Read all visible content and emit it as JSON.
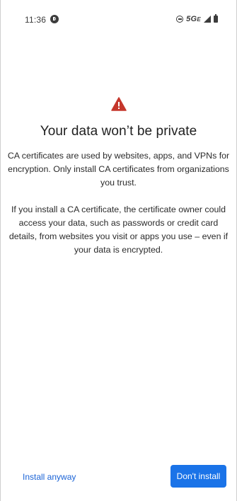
{
  "status_bar": {
    "time": "11:36",
    "network": "5G",
    "network_suffix": "E",
    "icons": [
      "app-notification-icon",
      "do-not-disturb-icon",
      "signal-icon",
      "battery-icon"
    ]
  },
  "dialog": {
    "icon": "warning-icon",
    "icon_color": "#c5372c",
    "title": "Your data won’t be private",
    "paragraph_1": "CA certificates are used by websites, apps, and VPNs for encryption. Only install CA certificates from organizations you trust.",
    "paragraph_2": "If you install a CA certificate, the certificate owner could access your data, such as passwords or credit card details, from websites you visit or apps you use – even if your data is encrypted."
  },
  "actions": {
    "install_anyway_label": "Install anyway",
    "dont_install_label": "Don't install",
    "accent_color": "#1a73e8"
  }
}
